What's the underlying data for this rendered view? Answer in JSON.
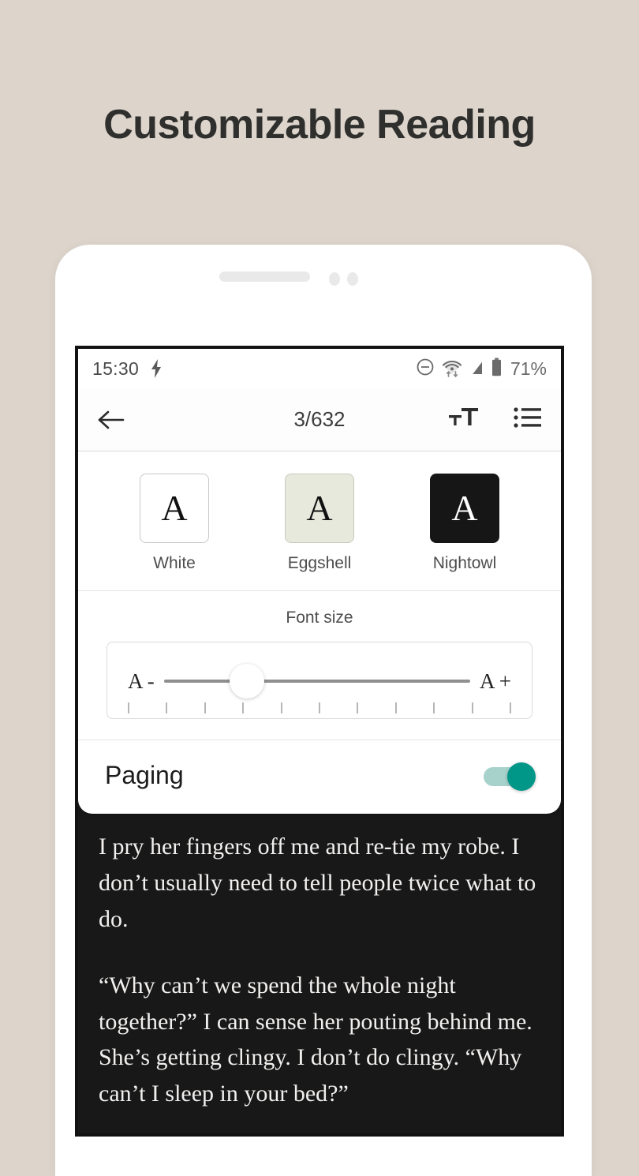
{
  "page": {
    "headline": "Customizable Reading",
    "background_color": "#ddd5cc",
    "headline_color": "#2f2f2d"
  },
  "status_bar": {
    "time": "15:30",
    "charging_icon": "bolt-icon",
    "dnd_icon": "do-not-disturb-icon",
    "wifi_icon": "wifi-data-icon",
    "signal_off_icon": "signal-off-icon",
    "battery_icon": "battery-icon",
    "battery_percent": "71%"
  },
  "toolbar": {
    "back_icon": "back-arrow-icon",
    "page_indicator": "3/632",
    "font_size_icon": "text-size-icon",
    "contents_icon": "table-of-contents-icon"
  },
  "settings": {
    "themes": [
      {
        "label": "White",
        "glyph": "A",
        "bg": "#ffffff",
        "fg": "#111111"
      },
      {
        "label": "Eggshell",
        "glyph": "A",
        "bg": "#e8e9dd",
        "fg": "#111111"
      },
      {
        "label": "Nightowl",
        "glyph": "A",
        "bg": "#161616",
        "fg": "#ffffff"
      }
    ],
    "font_size": {
      "title": "Font size",
      "decrease_label": "A -",
      "increase_label": "A +",
      "thumb_position_percent": 27,
      "tick_count": 11
    },
    "paging": {
      "label": "Paging",
      "enabled": true,
      "accent_color": "#009688",
      "track_color": "#a7d2cc"
    }
  },
  "reader": {
    "theme": "Nightowl",
    "background_color": "#181818",
    "text_color": "#f2f0ee",
    "paragraphs": [
      "I pry her fingers off me and re-tie my robe. I don’t usually need to tell people twice what to do.",
      "“Why can’t we spend the whole night together?” I can sense her pouting behind me. She’s getting clingy. I don’t do clingy. “Why can’t I sleep in your bed?”"
    ]
  }
}
